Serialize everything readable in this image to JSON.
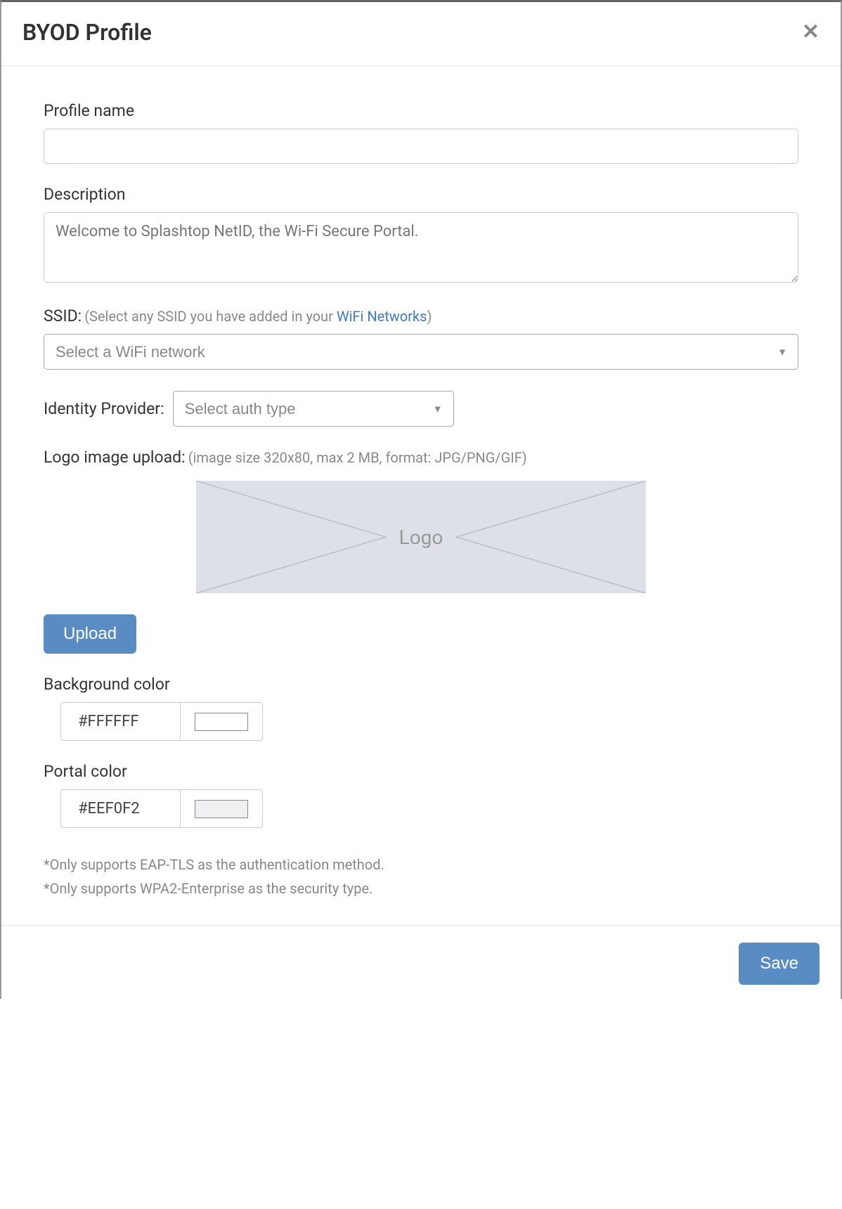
{
  "modal": {
    "title": "BYOD Profile"
  },
  "form": {
    "profileName": {
      "label": "Profile name",
      "value": ""
    },
    "description": {
      "label": "Description",
      "value": "Welcome to Splashtop NetID, the Wi-Fi Secure Portal."
    },
    "ssid": {
      "label": "SSID:",
      "hintPrefix": "(Select any SSID you have added in your ",
      "hintLink": "WiFi Networks",
      "hintSuffix": ")",
      "placeholder": "Select a WiFi network"
    },
    "identityProvider": {
      "label": "Identity Provider:",
      "placeholder": "Select auth type"
    },
    "logo": {
      "label": "Logo image upload:",
      "hint": "(image size 320x80, max 2 MB, format: JPG/PNG/GIF)",
      "placeholderText": "Logo",
      "uploadButton": "Upload"
    },
    "backgroundColor": {
      "label": "Background color",
      "value": "#FFFFFF",
      "swatch": "#FFFFFF"
    },
    "portalColor": {
      "label": "Portal color",
      "value": "#EEF0F2",
      "swatch": "#EEF0F2"
    },
    "notes": {
      "line1": "*Only supports EAP-TLS as the authentication method.",
      "line2": "*Only supports WPA2-Enterprise as the security type."
    }
  },
  "footer": {
    "saveButton": "Save"
  }
}
